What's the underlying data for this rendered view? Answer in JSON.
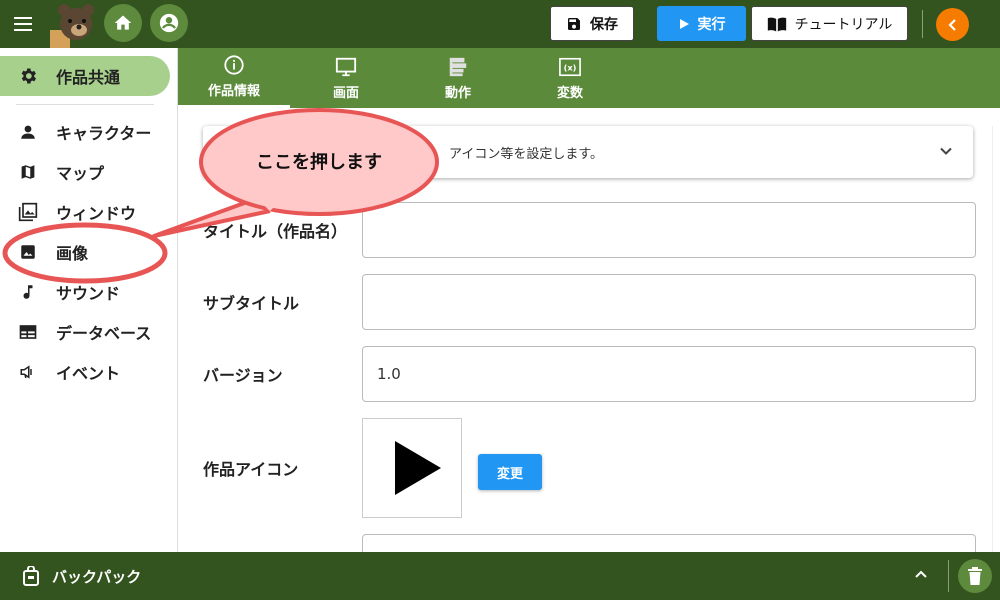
{
  "header": {
    "save_label": "保存",
    "run_label": "実行",
    "tutorial_label": "チュートリアル",
    "colors": {
      "bar": "#33541f",
      "run": "#2196f3",
      "collapse": "#f57c00"
    }
  },
  "sidebar": {
    "items": [
      {
        "label": "作品共通",
        "icon": "gear-icon",
        "active": true
      },
      {
        "label": "キャラクター",
        "icon": "person-icon"
      },
      {
        "label": "マップ",
        "icon": "map-icon"
      },
      {
        "label": "ウィンドウ",
        "icon": "window-image-icon"
      },
      {
        "label": "画像",
        "icon": "image-icon"
      },
      {
        "label": "サウンド",
        "icon": "music-note-icon"
      },
      {
        "label": "データベース",
        "icon": "table-icon"
      },
      {
        "label": "イベント",
        "icon": "megaphone-icon"
      }
    ]
  },
  "tabs": [
    {
      "label": "作品情報",
      "icon": "info-icon",
      "active": true
    },
    {
      "label": "画面",
      "icon": "monitor-icon"
    },
    {
      "label": "動作",
      "icon": "blocks-icon"
    },
    {
      "label": "変数",
      "icon": "variable-icon"
    }
  ],
  "content": {
    "expander_text": "アイコン等を設定します。",
    "fields": [
      {
        "label": "タイトル（作品名）",
        "value": ""
      },
      {
        "label": "サブタイトル",
        "value": ""
      },
      {
        "label": "バージョン",
        "value": "1.0"
      }
    ],
    "icon_label": "作品アイコン",
    "change_button": "変更"
  },
  "callout": {
    "text": "ここを押します",
    "fill": "#ffc9c9",
    "stroke": "#e85555"
  },
  "bottombar": {
    "label": "バックパック"
  }
}
